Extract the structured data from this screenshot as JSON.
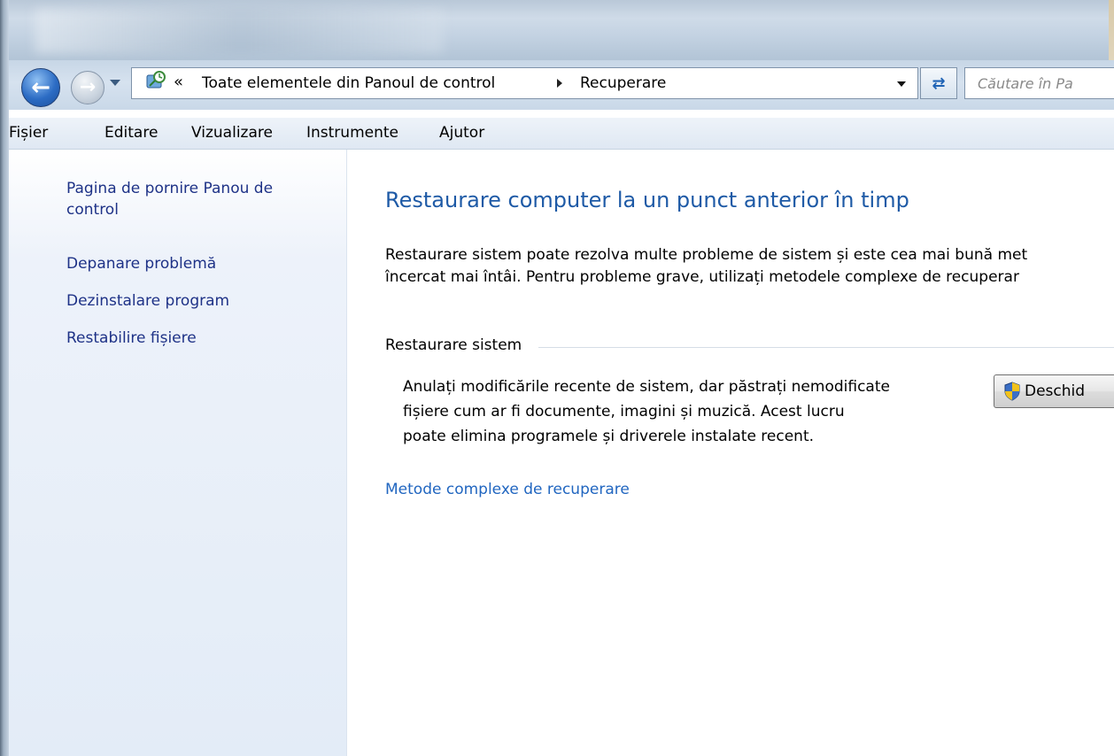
{
  "navigation": {
    "back_label": "Înapoi",
    "forward_label": "Înainte",
    "address": {
      "chevron": "«",
      "segments": [
        "Toate elementele din Panoul de control",
        "Recuperare"
      ]
    },
    "search_placeholder": "Căutare în Pa"
  },
  "menu": {
    "items": [
      "Fișier",
      "Editare",
      "Vizualizare",
      "Instrumente",
      "Ajutor"
    ]
  },
  "sidebar": {
    "items": [
      {
        "label_line1": "Pagina de pornire Panou de",
        "label_line2": "control"
      },
      {
        "label": "Depanare problemă"
      },
      {
        "label": "Dezinstalare program"
      },
      {
        "label": "Restabilire fișiere"
      }
    ]
  },
  "main": {
    "heading": "Restaurare computer la un punct anterior în timp",
    "description_line1": "Restaurare sistem poate rezolva multe probleme de sistem și este cea mai bună met",
    "description_line2": "încercat mai întâi. Pentru probleme grave, utilizați metodele complexe de recuperar",
    "group_title": "Restaurare sistem",
    "group_desc_line1": "Anulați modificările recente de sistem, dar păstrați nemodificate",
    "group_desc_line2": "fișiere cum ar fi documente, imagini și muzică. Acest lucru",
    "group_desc_line3": "poate elimina programele și driverele instalate recent.",
    "open_button_label": "Deschid",
    "advanced_link": "Metode complexe de recuperare"
  },
  "colors": {
    "heading": "#1e5aa6",
    "sidebar_link": "#1e3287",
    "content_link": "#2166c0"
  }
}
